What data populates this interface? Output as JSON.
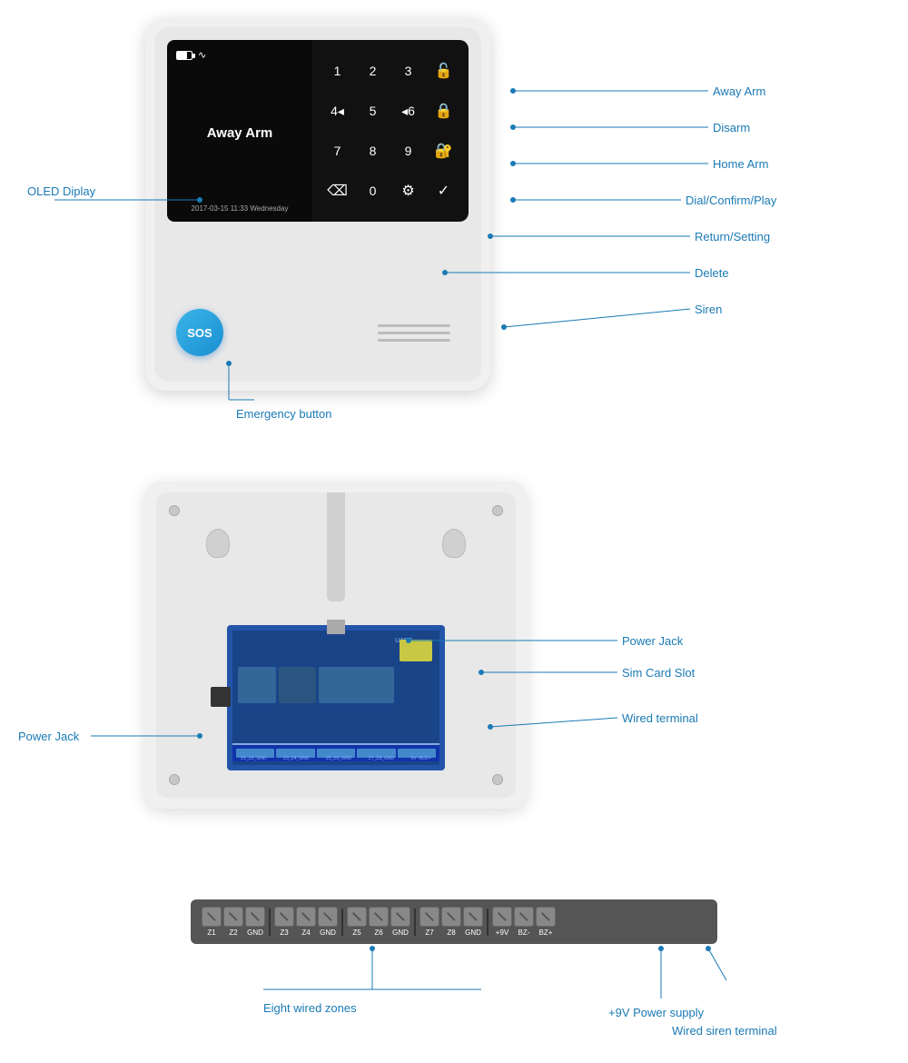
{
  "front_panel": {
    "oled": {
      "label": "OLED Diplay",
      "status_text": "Away Arm",
      "datetime": "2017-03-15   11:33  Wednesday"
    },
    "keys": [
      "1",
      "2",
      "3",
      "🔓",
      "4◂",
      "5",
      "◂6",
      "🔐",
      "7",
      "8",
      "9",
      "🔒",
      "⌫",
      "0",
      "⚙",
      "✓"
    ],
    "annotations": {
      "oled_display": "OLED Diplay",
      "away_arm": "Away Arm",
      "disarm": "Disarm",
      "home_arm": "Home Arm",
      "dial_confirm_play": "Dial/Confirm/Play",
      "return_setting": "Return/Setting",
      "delete": "Delete",
      "siren": "Siren",
      "sos": "SOS",
      "emergency_button": "Emergency button"
    }
  },
  "back_panel": {
    "annotations": {
      "power_jack_left": "Power Jack",
      "power_jack_right": "Power Jack",
      "sim_card_slot": "Sim Card Slot",
      "wired_terminal": "Wired terminal"
    }
  },
  "terminal_strip": {
    "labels": [
      "Z1",
      "Z2",
      "GND",
      "Z3",
      "Z4",
      "GND",
      "Z5",
      "Z6",
      "GND",
      "Z7",
      "Z8",
      "GND",
      "+9V",
      "BZ-",
      "BZ+"
    ],
    "annotations": {
      "eight_wired_zones": "Eight wired zones",
      "plus9v_power": "+9V Power supply",
      "wired_siren": "Wired siren terminal"
    }
  }
}
